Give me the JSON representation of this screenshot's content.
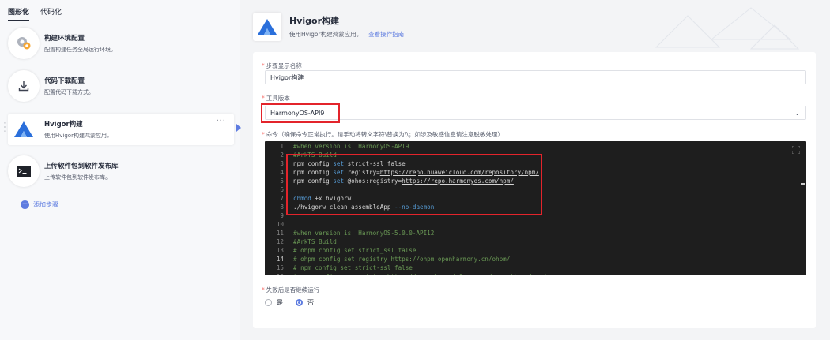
{
  "tabs": [
    "图形化",
    "代码化"
  ],
  "steps": [
    {
      "title": "构建环境配置",
      "desc": "配置构建任务全局运行环境。",
      "icon": "gear-cog-icon"
    },
    {
      "title": "代码下载配置",
      "desc": "配置代码下载方式。",
      "icon": "download-icon"
    },
    {
      "title": "Hvigor构建",
      "desc": "使用Hvigor构建鸿蒙应用。",
      "icon": "hvigor-logo-icon"
    },
    {
      "title": "上传软件包到软件发布库",
      "desc": "上传软件包到软件发布库。",
      "icon": "terminal-icon"
    }
  ],
  "more_label": "···",
  "add_step_label": "添加步骤",
  "header": {
    "title": "Hvigor构建",
    "subtitle": "使用Hvigor构建鸿蒙应用。",
    "guide_link": "查看操作指南"
  },
  "form": {
    "step_name_label": "步骤显示名称",
    "step_name_value": "Hvigor构建",
    "tool_version_label": "工具版本",
    "tool_version_value": "HarmonyOS-API9",
    "command_label": "命令（确保命令正常执行。请手动将转义字符\\替换为\\\\；如涉及敏感信息请注意脱敏处理）",
    "continue_label": "失败后是否继续运行",
    "options": [
      "是",
      "否"
    ]
  },
  "code_lines": [
    {
      "n": "1",
      "text": "#when version is  HarmonyOS-API9",
      "type": "comment"
    },
    {
      "n": "2",
      "text": "#ArkTS Build",
      "type": "comment"
    },
    {
      "n": "3",
      "text": "npm config set strict-ssl false",
      "type": "code"
    },
    {
      "n": "4",
      "text": "npm config set registry=https://repo.huaweicloud.com/repository/npm/",
      "type": "code"
    },
    {
      "n": "5",
      "text": "npm config set @ohos:registry=https://repo.harmonyos.com/npm/",
      "type": "code"
    },
    {
      "n": "6",
      "text": "",
      "type": "code"
    },
    {
      "n": "7",
      "text": "chmod +x hvigorw",
      "type": "code"
    },
    {
      "n": "8",
      "text": "./hvigorw clean assembleApp --no-daemon",
      "type": "code"
    },
    {
      "n": "9",
      "text": "",
      "type": "code"
    },
    {
      "n": "10",
      "text": "",
      "type": "code"
    },
    {
      "n": "11",
      "text": "#when version is  HarmonyOS-5.0.0-API12",
      "type": "comment"
    },
    {
      "n": "12",
      "text": "#ArkTS Build",
      "type": "comment"
    },
    {
      "n": "13",
      "text": "# ohpm config set strict_ssl false",
      "type": "comment"
    },
    {
      "n": "14",
      "text": "# ohpm config set registry https://ohpm.openharmony.cn/ohpm/",
      "type": "comment"
    },
    {
      "n": "15",
      "text": "# npm config set strict-ssl false",
      "type": "comment"
    },
    {
      "n": "16",
      "text": "# npm config set registry=https://repo.huaweicloud.com/repository/npm/",
      "type": "comment"
    }
  ],
  "colors": {
    "accent": "#5e7ce0",
    "highlight": "#e3242b",
    "editor_bg": "#1e1e1e"
  }
}
